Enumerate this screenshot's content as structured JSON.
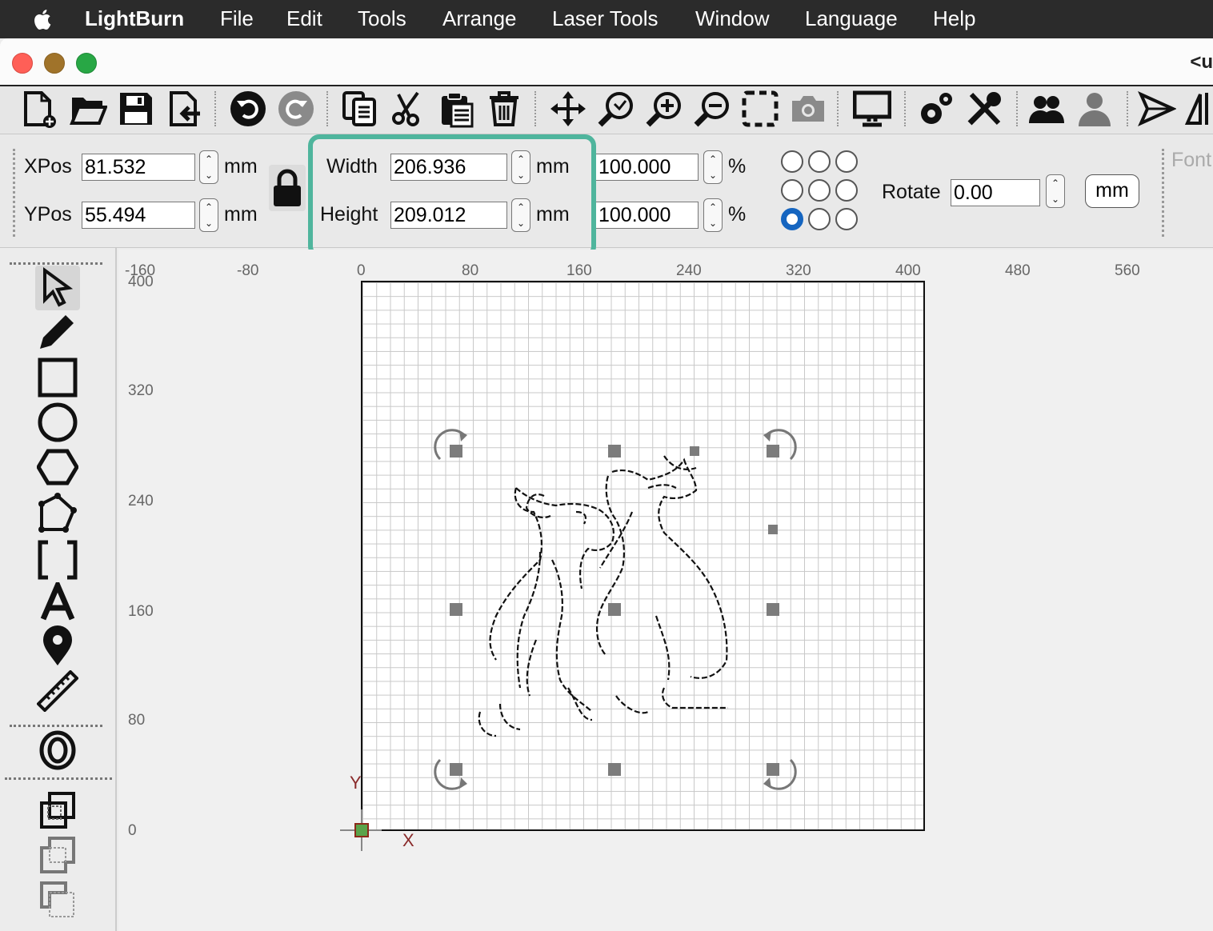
{
  "menubar": {
    "app_name": "LightBurn",
    "items": [
      "File",
      "Edit",
      "Tools",
      "Arrange",
      "Laser Tools",
      "Window",
      "Language",
      "Help"
    ]
  },
  "window": {
    "title_fragment": "<u",
    "traffic_lights": [
      "#ff5f57",
      "#a0732a",
      "#28a745"
    ]
  },
  "toolbar": {
    "icons": [
      "new-file-icon",
      "open-folder-icon",
      "save-icon",
      "import-icon",
      "undo-icon",
      "redo-icon",
      "copy-icon",
      "cut-icon",
      "paste-icon",
      "delete-icon",
      "move-icon",
      "zoom-selection-icon",
      "zoom-in-icon",
      "zoom-out-icon",
      "select-frame-icon",
      "camera-icon",
      "monitor-icon",
      "settings-icon",
      "tools-icon",
      "users-icon",
      "user-icon",
      "send-icon",
      "mirror-icon"
    ]
  },
  "properties": {
    "xpos_label": "XPos",
    "xpos_value": "81.532",
    "ypos_label": "YPos",
    "ypos_value": "55.494",
    "width_label": "Width",
    "width_value": "206.936",
    "height_label": "Height",
    "height_value": "209.012",
    "unit": "mm",
    "scale_x_value": "100.000",
    "scale_y_value": "100.000",
    "percent": "%",
    "rotate_label": "Rotate",
    "rotate_value": "0.00",
    "units_button": "mm",
    "font_label": "Font",
    "anchor_selected": 6,
    "highlight_color": "#4fb59d"
  },
  "ruler": {
    "x_ticks": [
      "-160",
      "-80",
      "0",
      "80",
      "160",
      "240",
      "320",
      "400",
      "480",
      "560"
    ],
    "y_ticks": [
      "400",
      "320",
      "240",
      "160",
      "80",
      "0"
    ],
    "x_axis_label": "X",
    "y_axis_label": "Y"
  },
  "left_tools": [
    "select-icon",
    "pencil-icon",
    "rectangle-icon",
    "ellipse-icon",
    "polygon-icon",
    "polyline-icon",
    "frame-icon",
    "text-icon",
    "position-icon",
    "measure-icon",
    "offset-icon",
    "weld-icon",
    "union-icon",
    "subtract-icon"
  ]
}
